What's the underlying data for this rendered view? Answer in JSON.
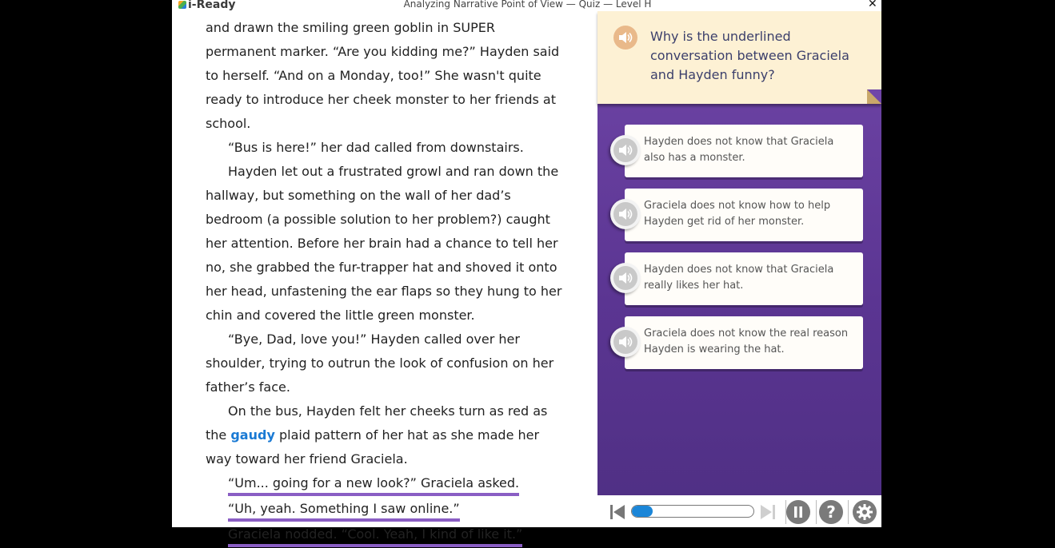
{
  "app": {
    "logo_text": "i-Ready",
    "window_title": "Analyzing Narrative Point of View — Quiz — Level H",
    "close_glyph": "✕"
  },
  "passage": {
    "p1": "and drawn the smiling green goblin in SUPER permanent marker. “Are you kidding me?” Hayden said to herself. “And on a Monday, too!” She wasn't quite ready to introduce her cheek monster to her friends at school.",
    "p2": "“Bus is here!” her dad called from downstairs.",
    "p3": "Hayden let out a frustrated growl and ran down the hallway, but something on the wall of her dad’s bedroom (a possible solution to her problem?) caught her attention. Before her brain had a chance to tell her no, she grabbed the fur-trapper hat and shoved it onto her head, unfastening the ear flaps so they hung to her chin and covered the little green monster.",
    "p4": "“Bye, Dad, love you!” Hayden called over her shoulder, trying to outrun the look of confusion on her father’s face.",
    "p5_before": "On the bus, Hayden felt her cheeks turn as red as the ",
    "p5_vocab": "gaudy",
    "p5_after": " plaid pattern of her hat as she made her way toward her friend Graciela.",
    "underlined": [
      "“Um... going for a new look?” Graciela asked.",
      "“Uh, yeah. Something I saw online.”",
      "Graciela nodded. “Cool. Yeah, I kind of like it.”"
    ]
  },
  "quiz": {
    "question": "Why is the underlined conversation between Graciela and Hayden funny?",
    "answers": [
      "Hayden does not know that Graciela also has a monster.",
      "Graciela does not know how to help Hayden get rid of her monster.",
      "Hayden does not know that Graciela really likes her hat.",
      "Graciela does not know the real reason Hayden is wearing the hat."
    ]
  },
  "controls": {
    "progress_fraction": 0.17,
    "help_glyph": "?",
    "icons": [
      "skip-back-icon",
      "skip-forward-icon",
      "pause-icon",
      "help-icon",
      "settings-icon",
      "speaker-icon"
    ]
  },
  "colors": {
    "quiz_purple": "#6a40a2",
    "question_bg": "#fdf1d4",
    "underline": "#8a5ec4",
    "vocab": "#1a7ad4",
    "progress": "#1b86d8"
  }
}
